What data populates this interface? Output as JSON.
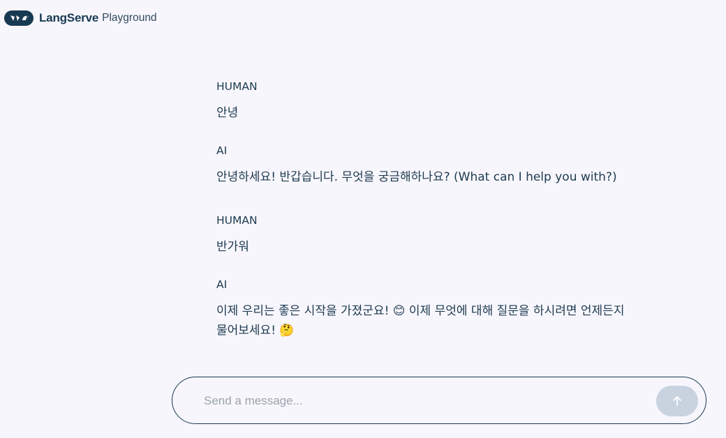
{
  "header": {
    "brand": "LangServe",
    "subtitle": "Playground",
    "logo_icon": "parrot-chain-logo-icon"
  },
  "messages": [
    {
      "role": "HUMAN",
      "text": "안녕"
    },
    {
      "role": "AI",
      "text": "안녕하세요! 반갑습니다. 무엇을 궁금해하나요? (What can I help you with?)"
    },
    {
      "role": "HUMAN",
      "text": "반가워"
    },
    {
      "role": "AI",
      "text": "이제 우리는 좋은 시작을 가졌군요! 😊 이제 무엇에 대해 질문을 하시려면 언제든지 물어보세요! 🤔"
    }
  ],
  "composer": {
    "placeholder": "Send a message...",
    "value": "",
    "send_icon": "arrow-up-icon"
  },
  "colors": {
    "background": "#f8f6fd",
    "text": "#1c3a4f",
    "brand": "#173a52",
    "send_button": "#c8d3df"
  }
}
